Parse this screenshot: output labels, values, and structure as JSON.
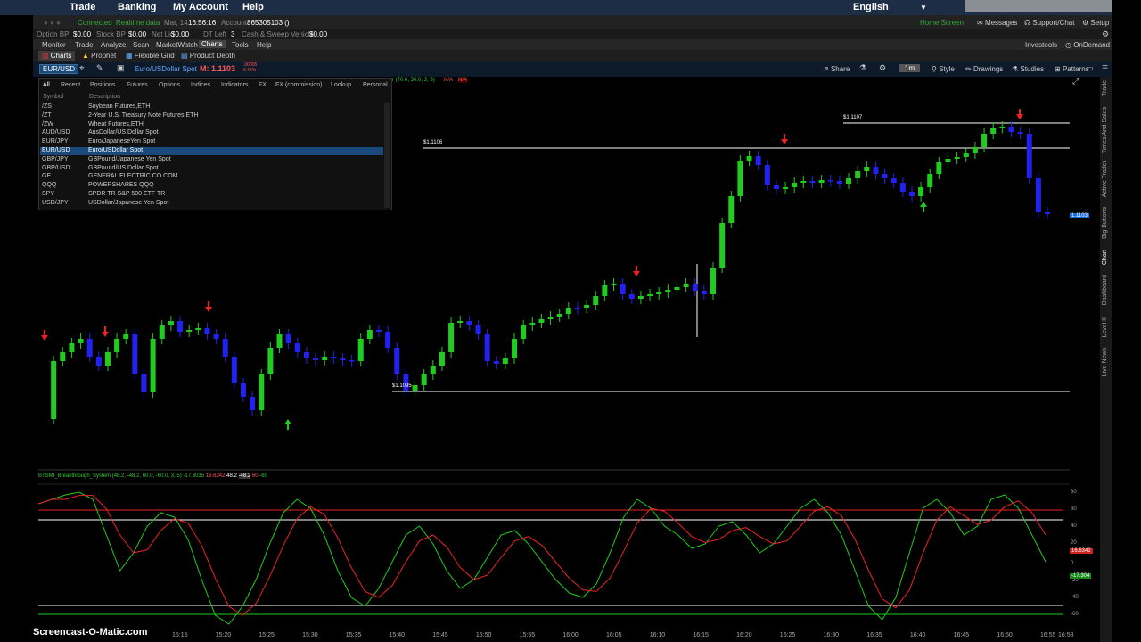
{
  "topnav": {
    "items": [
      "Trade",
      "Banking",
      "My Account",
      "Help"
    ],
    "language": "English"
  },
  "status": {
    "connected": "Connected",
    "realtime": "Realtime data",
    "date": "Mar, 14",
    "time": "16:56:16",
    "account_label": "Account:",
    "account": "865305103 ()",
    "home_screen": "Home Screen",
    "messages": "Messages",
    "support": "Support/Chat",
    "setup": "Setup"
  },
  "account": {
    "option_bp_label": "Option BP",
    "option_bp": "$0.00",
    "stock_bp_label": "Stock BP",
    "stock_bp": "$0.00",
    "net_liq_label": "Net Liq",
    "net_liq": "$0.00",
    "dt_left_label": "DT Left",
    "dt_left": "3",
    "cash_label": "Cash & Sweep Vehicle",
    "cash": "$0.00"
  },
  "menu": {
    "items": [
      "Monitor",
      "Trade",
      "Analyze",
      "Scan",
      "MarketWatch",
      "Charts",
      "Tools",
      "Help"
    ],
    "investools": "Investools",
    "ondemand": "OnDemand"
  },
  "subbar": {
    "charts": "Charts",
    "prophet": "Prophet",
    "flexible_grid": "Flexible Grid",
    "product_depth": "Product Depth"
  },
  "chartbar": {
    "symbol": "EUR/USD",
    "description": "Euro/USDollar Spot",
    "mark": "M: 1.1103",
    "change1": ".00005",
    "change2": "0.45%",
    "share": "Share",
    "timeframe": "1m",
    "style": "Style",
    "drawings": "Drawings",
    "studies": "Studies",
    "patterns": "Patterns",
    "study_params": "r (70.0, 30.0, 3, 5)",
    "na1": "N/A",
    "na2": "N/A"
  },
  "symbol_list": {
    "tabs": [
      "All",
      "Recent",
      "Positions",
      "Futures",
      "Options",
      "Indices",
      "Indicators",
      "FX",
      "FX (commission)",
      "Lookup",
      "Personal"
    ],
    "col_symbol": "Symbol",
    "col_description": "Description",
    "rows": [
      {
        "symbol": "/ZS",
        "description": "Soybean Futures,ETH"
      },
      {
        "symbol": "/ZT",
        "description": "2-Year U.S. Treasury Note Futures,ETH"
      },
      {
        "symbol": "/ZW",
        "description": "Wheat Futures,ETH"
      },
      {
        "symbol": "AUD/USD",
        "description": "AusDollar/US Dollar Spot"
      },
      {
        "symbol": "EUR/JPY",
        "description": "Euro/JapaneseYen Spot"
      },
      {
        "symbol": "EUR/USD",
        "description": "Euro/USDollar Spot"
      },
      {
        "symbol": "GBP/JPY",
        "description": "GBPound/Japanese Yen Spot"
      },
      {
        "symbol": "GBP/USD",
        "description": "GBPound/US Dollar Spot"
      },
      {
        "symbol": "GE",
        "description": "GENERAL ELECTRIC CO COM"
      },
      {
        "symbol": "QQQ",
        "description": "POWERSHARES QQQ"
      },
      {
        "symbol": "SPY",
        "description": "SPDR TR S&P 500 ETF TR"
      },
      {
        "symbol": "USD/JPY",
        "description": "USDollar/Japanese Yen Spot"
      }
    ],
    "selected_index": 5
  },
  "price_levels": {
    "l1": "$1.1106",
    "l2": "$1.1107",
    "l3": "$1.1095",
    "current": "1.1103"
  },
  "oscillator": {
    "label": "BTSMI_Breakthrough_System (48.2, -48.2, 60.0, -60.0, 3, 5)",
    "v1": "-17.3035",
    "v2": "16.6342",
    "v3": "48.2",
    "v4": "-48.2",
    "v5": "60",
    "v6": "-60",
    "axis": [
      "80",
      "60",
      "40",
      "20",
      "0",
      "-20",
      "-40",
      "-60"
    ],
    "tag_red": "16.6342",
    "tag_green": "-17.304"
  },
  "times": [
    "15:15",
    "15:20",
    "15:25",
    "15:30",
    "15:35",
    "15:40",
    "15:45",
    "15:50",
    "15:55",
    "16:00",
    "16:05",
    "16:10",
    "16:15",
    "16:20",
    "16:25",
    "16:30",
    "16:35",
    "16:40",
    "16:45",
    "16:50",
    "16:55",
    "16:58"
  ],
  "right_tabs": [
    "Trade",
    "Times And Sales",
    "Active Trader",
    "Big Buttons",
    "Chart",
    "Dashboard",
    "Level II",
    "Live News"
  ],
  "watermark": "Screencast-O-Matic.com",
  "colors": {
    "up": "#1fcc1f",
    "down": "#2222ee",
    "nav": "#1c2d45"
  }
}
